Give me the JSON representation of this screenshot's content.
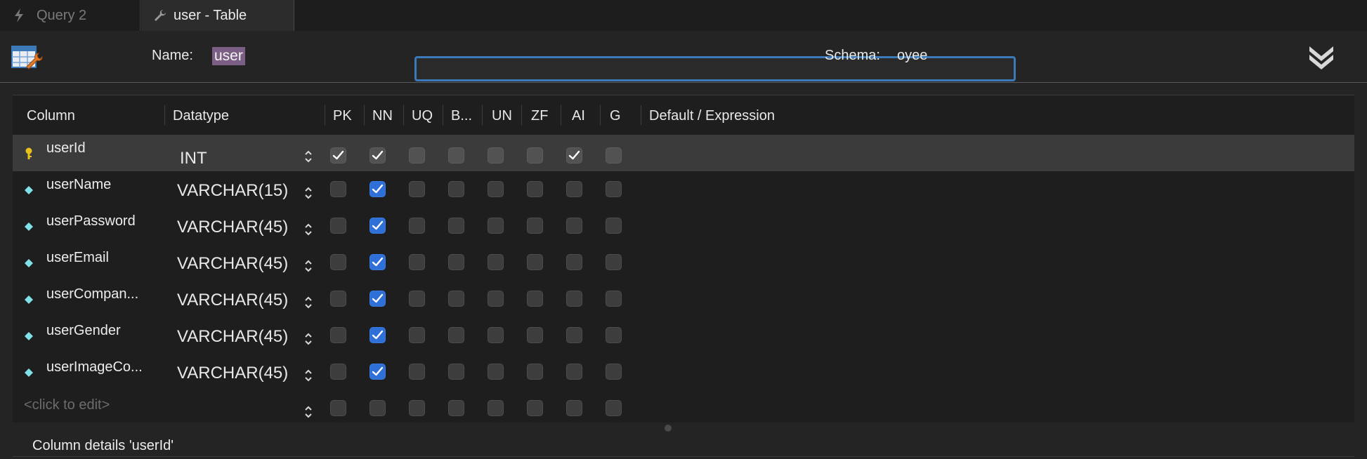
{
  "tabs": [
    {
      "label": "Query 2",
      "icon": "lightning-icon"
    },
    {
      "label": "user - Table",
      "icon": "wrench-icon"
    }
  ],
  "header": {
    "name_label": "Name:",
    "name_value": "user",
    "schema_label": "Schema:",
    "schema_value": "oyee"
  },
  "grid": {
    "headers": {
      "column": "Column",
      "datatype": "Datatype",
      "pk": "PK",
      "nn": "NN",
      "uq": "UQ",
      "b": "B...",
      "un": "UN",
      "zf": "ZF",
      "ai": "AI",
      "g": "G",
      "default": "Default / Expression"
    },
    "rows": [
      {
        "name": "userId",
        "datatype": "INT",
        "icon": "key-icon",
        "pk": true,
        "nn": true,
        "uq": false,
        "b": false,
        "un": false,
        "zf": false,
        "ai": true,
        "g": false
      },
      {
        "name": "userName",
        "datatype": "VARCHAR(15)",
        "icon": "diamond-icon",
        "pk": false,
        "nn": true,
        "uq": false,
        "b": false,
        "un": false,
        "zf": false,
        "ai": false,
        "g": false
      },
      {
        "name": "userPassword",
        "datatype": "VARCHAR(45)",
        "icon": "diamond-icon",
        "pk": false,
        "nn": true,
        "uq": false,
        "b": false,
        "un": false,
        "zf": false,
        "ai": false,
        "g": false
      },
      {
        "name": "userEmail",
        "datatype": "VARCHAR(45)",
        "icon": "diamond-icon",
        "pk": false,
        "nn": true,
        "uq": false,
        "b": false,
        "un": false,
        "zf": false,
        "ai": false,
        "g": false
      },
      {
        "name": "userCompan...",
        "datatype": "VARCHAR(45)",
        "icon": "diamond-icon",
        "pk": false,
        "nn": true,
        "uq": false,
        "b": false,
        "un": false,
        "zf": false,
        "ai": false,
        "g": false
      },
      {
        "name": "userGender",
        "datatype": "VARCHAR(45)",
        "icon": "diamond-icon",
        "pk": false,
        "nn": true,
        "uq": false,
        "b": false,
        "un": false,
        "zf": false,
        "ai": false,
        "g": false
      },
      {
        "name": "userImageCo...",
        "datatype": "VARCHAR(45)",
        "icon": "diamond-icon",
        "pk": false,
        "nn": true,
        "uq": false,
        "b": false,
        "un": false,
        "zf": false,
        "ai": false,
        "g": false
      }
    ],
    "new_row_placeholder": "<click to edit>"
  },
  "details": {
    "label": "Column details 'userId'"
  },
  "colors": {
    "accent": "#2e6fd8",
    "focus_ring": "#3c79b8",
    "selection": "#7c5f85",
    "key_icon": "#e8c21a",
    "diamond_icon": "#7fe0e8"
  }
}
